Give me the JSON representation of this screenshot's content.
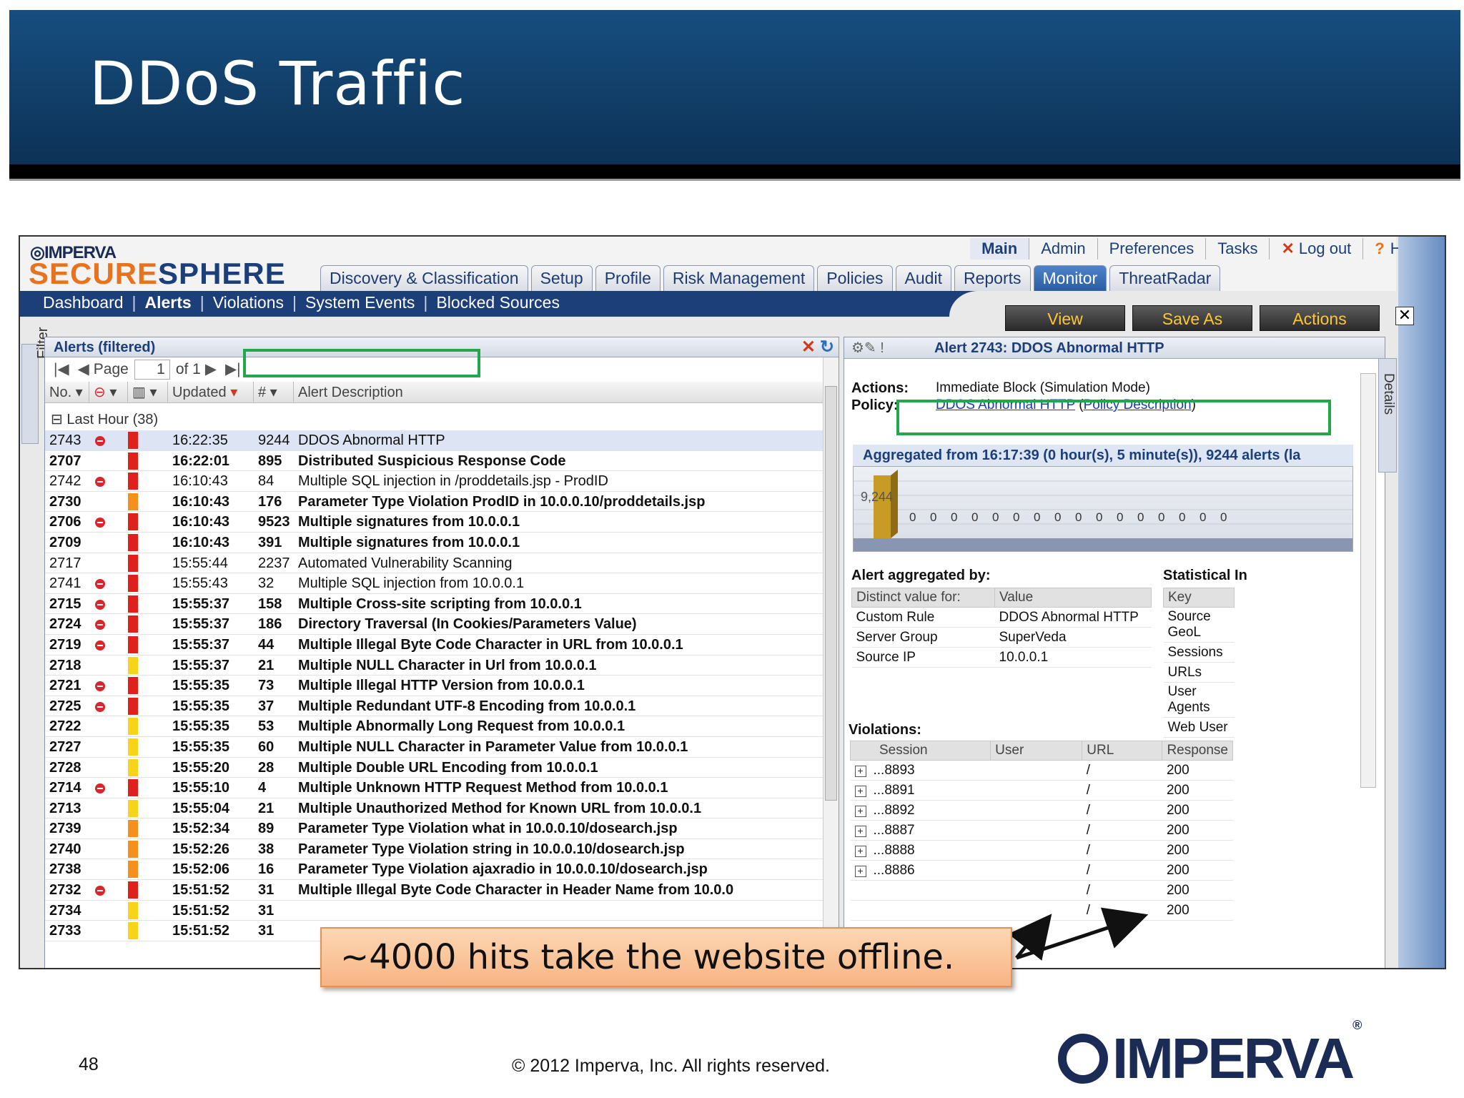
{
  "slide": {
    "title": "DDoS Traffic",
    "page_number": "48",
    "copyright": "© 2012 Imperva, Inc.  All rights reserved.",
    "footer_logo": "IMPERVA",
    "callout": "~4000 hits take the website offline."
  },
  "app": {
    "logo_top": "IMPERVA",
    "logo_secure": "SECURE",
    "logo_sphere": "SPHERE",
    "top_menu": [
      {
        "label": "Main"
      },
      {
        "label": "Admin"
      },
      {
        "label": "Preferences"
      },
      {
        "label": "Tasks"
      },
      {
        "label": "Log out"
      },
      {
        "label": "Help"
      }
    ],
    "tabs": [
      {
        "label": "Discovery & Classification"
      },
      {
        "label": "Setup"
      },
      {
        "label": "Profile"
      },
      {
        "label": "Risk Management"
      },
      {
        "label": "Policies"
      },
      {
        "label": "Audit"
      },
      {
        "label": "Reports"
      },
      {
        "label": "Monitor"
      },
      {
        "label": "ThreatRadar"
      }
    ],
    "selected_tab": "Monitor",
    "subnav": [
      {
        "label": "Dashboard"
      },
      {
        "label": "Alerts"
      },
      {
        "label": "Violations"
      },
      {
        "label": "System Events"
      },
      {
        "label": "Blocked Sources"
      }
    ],
    "action_buttons": [
      {
        "label": "View"
      },
      {
        "label": "Save As"
      },
      {
        "label": "Actions"
      }
    ],
    "filter_label": "Filter",
    "details_label": "Details"
  },
  "alerts": {
    "title": "Alerts (filtered)",
    "pager": {
      "page_label": "Page",
      "page": "1",
      "of_label": "of 1"
    },
    "columns": [
      "No.",
      "",
      "",
      "Updated",
      "#",
      "Alert Description"
    ],
    "group": "Last Hour (38)",
    "colors": {
      "red": "#e0201a",
      "orange": "#f5901e",
      "yellow": "#f7d417"
    },
    "rows": [
      {
        "no": "2743",
        "blocked": true,
        "sev": "red",
        "updated": "16:22:35",
        "count": "9244",
        "desc": "DDOS Abnormal HTTP",
        "bold": false,
        "selected": true
      },
      {
        "no": "2707",
        "blocked": false,
        "sev": "red",
        "updated": "16:22:01",
        "count": "895",
        "desc": "Distributed Suspicious Response Code",
        "bold": true
      },
      {
        "no": "2742",
        "blocked": true,
        "sev": "red",
        "updated": "16:10:43",
        "count": "84",
        "desc": "Multiple SQL injection in /proddetails.jsp - ProdID",
        "bold": false
      },
      {
        "no": "2730",
        "blocked": false,
        "sev": "orange",
        "updated": "16:10:43",
        "count": "176",
        "desc": "Parameter Type Violation ProdID in 10.0.0.10/proddetails.jsp",
        "bold": true
      },
      {
        "no": "2706",
        "blocked": true,
        "sev": "red",
        "updated": "16:10:43",
        "count": "9523",
        "desc": "Multiple signatures from 10.0.0.1",
        "bold": true
      },
      {
        "no": "2709",
        "blocked": false,
        "sev": "red",
        "updated": "16:10:43",
        "count": "391",
        "desc": "Multiple signatures from 10.0.0.1",
        "bold": true
      },
      {
        "no": "2717",
        "blocked": false,
        "sev": "red",
        "updated": "15:55:44",
        "count": "2237",
        "desc": "Automated Vulnerability Scanning",
        "bold": false
      },
      {
        "no": "2741",
        "blocked": true,
        "sev": "red",
        "updated": "15:55:43",
        "count": "32",
        "desc": "Multiple SQL injection from 10.0.0.1",
        "bold": false
      },
      {
        "no": "2715",
        "blocked": true,
        "sev": "red",
        "updated": "15:55:37",
        "count": "158",
        "desc": "Multiple Cross-site scripting from 10.0.0.1",
        "bold": true
      },
      {
        "no": "2724",
        "blocked": true,
        "sev": "red",
        "updated": "15:55:37",
        "count": "186",
        "desc": "Directory Traversal (In Cookies/Parameters Value)",
        "bold": true
      },
      {
        "no": "2719",
        "blocked": true,
        "sev": "red",
        "updated": "15:55:37",
        "count": "44",
        "desc": "Multiple Illegal Byte Code Character in URL from 10.0.0.1",
        "bold": true
      },
      {
        "no": "2718",
        "blocked": false,
        "sev": "yellow",
        "updated": "15:55:37",
        "count": "21",
        "desc": "Multiple NULL Character in Url from 10.0.0.1",
        "bold": true
      },
      {
        "no": "2721",
        "blocked": true,
        "sev": "red",
        "updated": "15:55:35",
        "count": "73",
        "desc": "Multiple Illegal HTTP Version from 10.0.0.1",
        "bold": true
      },
      {
        "no": "2725",
        "blocked": true,
        "sev": "red",
        "updated": "15:55:35",
        "count": "37",
        "desc": "Multiple Redundant UTF-8 Encoding from 10.0.0.1",
        "bold": true
      },
      {
        "no": "2722",
        "blocked": false,
        "sev": "yellow",
        "updated": "15:55:35",
        "count": "53",
        "desc": "Multiple Abnormally Long Request from 10.0.0.1",
        "bold": true
      },
      {
        "no": "2727",
        "blocked": false,
        "sev": "yellow",
        "updated": "15:55:35",
        "count": "60",
        "desc": "Multiple NULL Character in Parameter Value from 10.0.0.1",
        "bold": true
      },
      {
        "no": "2728",
        "blocked": false,
        "sev": "yellow",
        "updated": "15:55:20",
        "count": "28",
        "desc": "Multiple Double URL Encoding from 10.0.0.1",
        "bold": true
      },
      {
        "no": "2714",
        "blocked": true,
        "sev": "red",
        "updated": "15:55:10",
        "count": "4",
        "desc": "Multiple Unknown HTTP Request Method from 10.0.0.1",
        "bold": true
      },
      {
        "no": "2713",
        "blocked": false,
        "sev": "yellow",
        "updated": "15:55:04",
        "count": "21",
        "desc": "Multiple Unauthorized Method for Known URL from 10.0.0.1",
        "bold": true
      },
      {
        "no": "2739",
        "blocked": false,
        "sev": "orange",
        "updated": "15:52:34",
        "count": "89",
        "desc": "Parameter Type Violation what in 10.0.0.10/dosearch.jsp",
        "bold": true
      },
      {
        "no": "2740",
        "blocked": false,
        "sev": "orange",
        "updated": "15:52:26",
        "count": "38",
        "desc": "Parameter Type Violation string in 10.0.0.10/dosearch.jsp",
        "bold": true
      },
      {
        "no": "2738",
        "blocked": false,
        "sev": "orange",
        "updated": "15:52:06",
        "count": "16",
        "desc": "Parameter Type Violation ajaxradio in 10.0.0.10/dosearch.jsp",
        "bold": true
      },
      {
        "no": "2732",
        "blocked": true,
        "sev": "red",
        "updated": "15:51:52",
        "count": "31",
        "desc": "Multiple Illegal Byte Code Character in Header Name from 10.0.0",
        "bold": true
      },
      {
        "no": "2734",
        "blocked": false,
        "sev": "yellow",
        "updated": "15:51:52",
        "count": "31",
        "desc": "",
        "bold": true
      },
      {
        "no": "2733",
        "blocked": false,
        "sev": "yellow",
        "updated": "15:51:52",
        "count": "31",
        "desc": "",
        "bold": true
      }
    ]
  },
  "detail": {
    "title": "Alert 2743: DDOS Abnormal HTTP",
    "actions_label": "Actions:",
    "actions_value": "Immediate Block (Simulation Mode)",
    "policy_label": "Policy:",
    "policy_link": "DDOS Abnormal HTTP",
    "policy_desc": "Policy Description",
    "aggregated": "Aggregated from  16:17:39 (0 hour(s), 5 minute(s)), 9244  alerts (la",
    "chart_bar_label": "9,244",
    "chart_zeros": [
      "0",
      "0",
      "0",
      "0",
      "0",
      "0",
      "0",
      "0",
      "0",
      "0",
      "0",
      "0",
      "0",
      "0",
      "0",
      "0"
    ],
    "agg_by_label": "Alert aggregated by:",
    "agg_headers": [
      "Distinct value for:",
      "Value"
    ],
    "agg_rows": [
      {
        "k": "Custom Rule",
        "v": "DDOS Abnormal HTTP"
      },
      {
        "k": "Server Group",
        "v": "SuperVeda"
      },
      {
        "k": "Source IP",
        "v": "10.0.0.1"
      }
    ],
    "stat_label": "Statistical In",
    "stat_header": "Key",
    "stat_rows": [
      "Source GeoL",
      "Sessions",
      "URLs",
      "User Agents",
      "Web User"
    ],
    "violations_label": "Violations:",
    "viol_headers": [
      "Session",
      "User",
      "URL",
      "Response"
    ],
    "viol_rows": [
      {
        "session": "...8893",
        "user": "",
        "url": "/",
        "resp": "200",
        "expander": true
      },
      {
        "session": "...8891",
        "user": "",
        "url": "/",
        "resp": "200",
        "expander": true
      },
      {
        "session": "...8892",
        "user": "",
        "url": "/",
        "resp": "200",
        "expander": true
      },
      {
        "session": "...8887",
        "user": "",
        "url": "/",
        "resp": "200",
        "expander": true
      },
      {
        "session": "...8888",
        "user": "",
        "url": "/",
        "resp": "200",
        "expander": true
      },
      {
        "session": "...8886",
        "user": "",
        "url": "/",
        "resp": "200",
        "expander": true
      },
      {
        "session": "",
        "user": "",
        "url": "/",
        "resp": "200",
        "expander": false
      },
      {
        "session": "",
        "user": "",
        "url": "/",
        "resp": "200",
        "expander": false
      }
    ]
  }
}
